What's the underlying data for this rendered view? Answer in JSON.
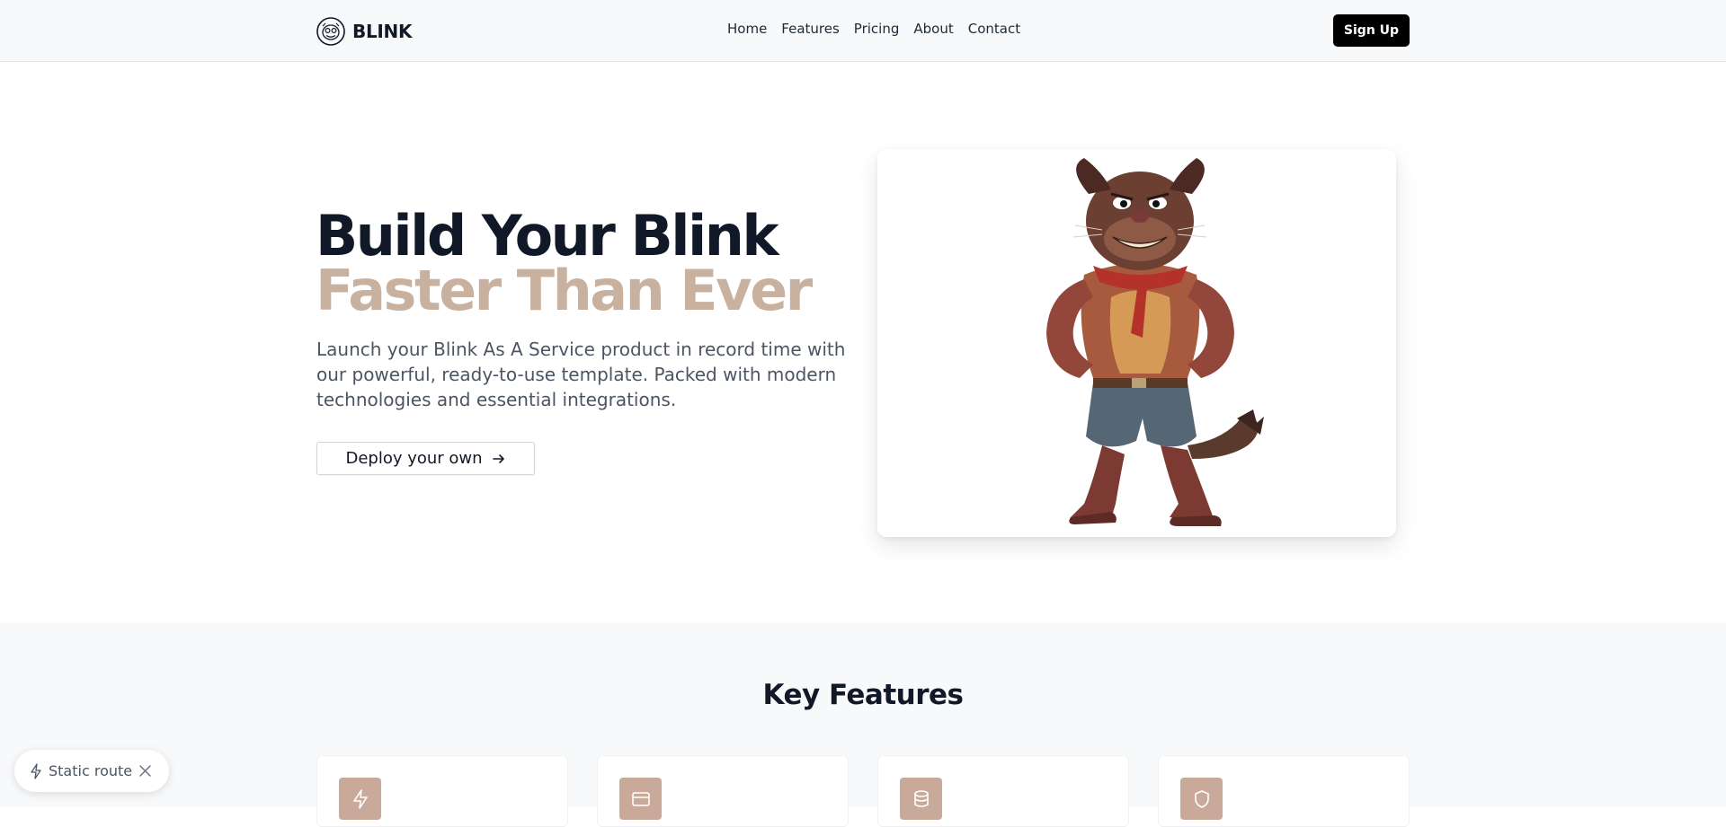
{
  "navbar": {
    "brand": "BLINK",
    "links": [
      "Home",
      "Features",
      "Pricing",
      "About",
      "Contact"
    ],
    "signup_label": "Sign Up"
  },
  "hero": {
    "title_line1": "Build Your Blink",
    "title_line2": "Faster Than Ever",
    "description": "Launch your Blink As A Service product in record time with our powerful, ready-to-use template. Packed with modern technologies and essential integrations.",
    "cta_label": "Deploy your own",
    "cta_icon": "arrow-right-icon",
    "image": "mascot-dog-illustration"
  },
  "features": {
    "title": "Key Features",
    "cards": [
      {
        "icon": "lightning-icon"
      },
      {
        "icon": "credit-card-icon"
      },
      {
        "icon": "database-icon"
      },
      {
        "icon": "shield-icon"
      }
    ]
  },
  "route_badge": {
    "label": "Static route",
    "icon": "lightning-icon",
    "close_icon": "close-icon"
  },
  "colors": {
    "primary_text": "#111827",
    "accent": "#c9b1a0",
    "feature_icon_bg": "#c9a999",
    "button_dark": "#000000"
  }
}
